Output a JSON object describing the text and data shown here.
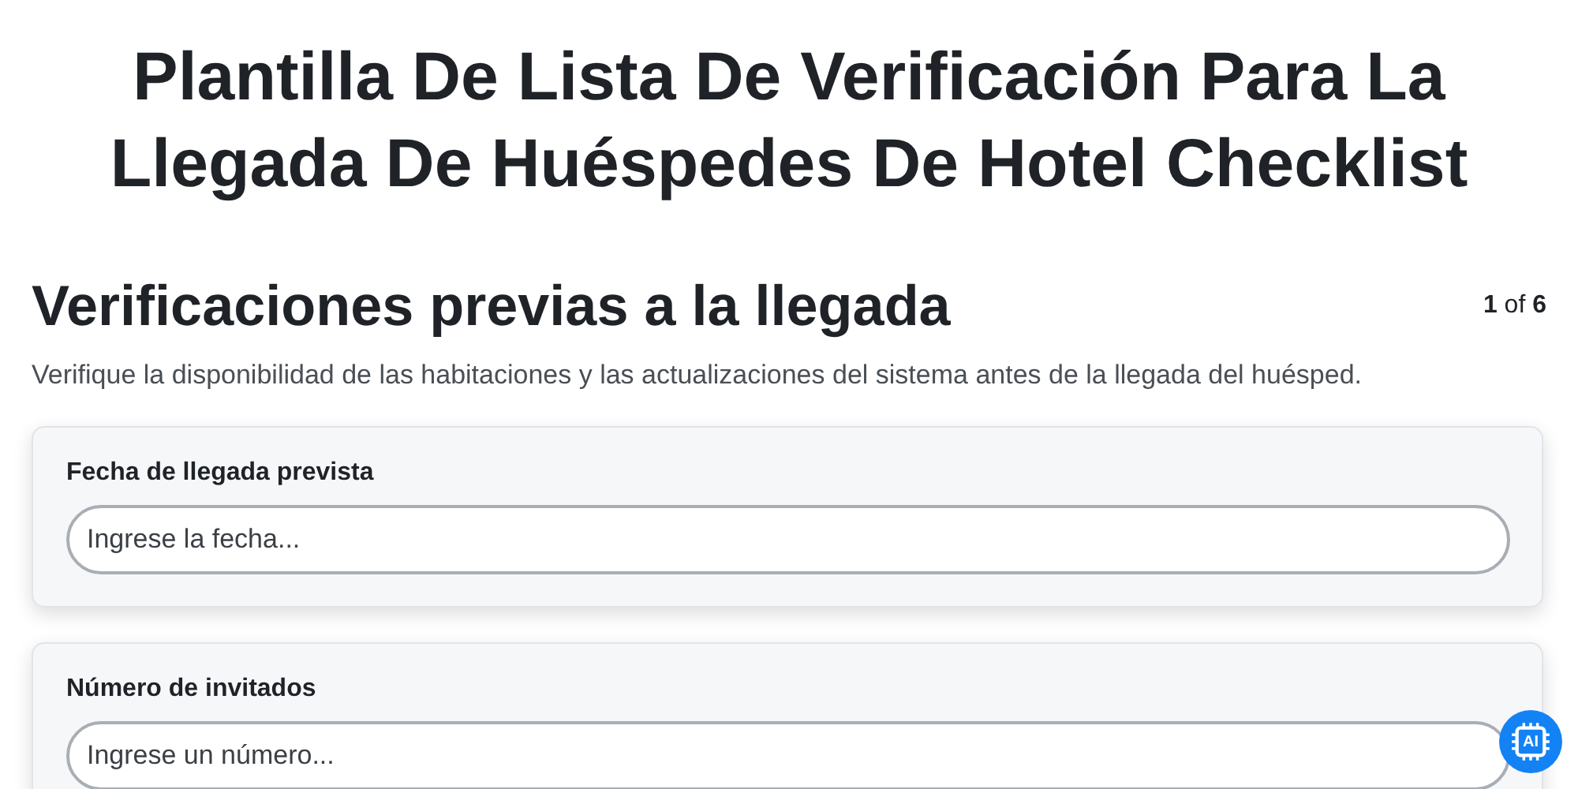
{
  "title": "Plantilla De Lista De Verificación Para La Llegada De Huéspedes De Hotel Checklist",
  "section": {
    "heading": "Verificaciones previas a la llegada",
    "pager": "**1** of **6**",
    "description": "Verifique la disponibilidad de las habitaciones y las actualizaciones del sistema antes de la llegada del huésped."
  },
  "fields": [
    {
      "label": "Fecha de llegada prevista",
      "placeholder": "Ingrese la fecha..."
    },
    {
      "label": "Número de invitados",
      "placeholder": "Ingrese un número..."
    }
  ],
  "ai_button": {
    "label": "AI"
  }
}
